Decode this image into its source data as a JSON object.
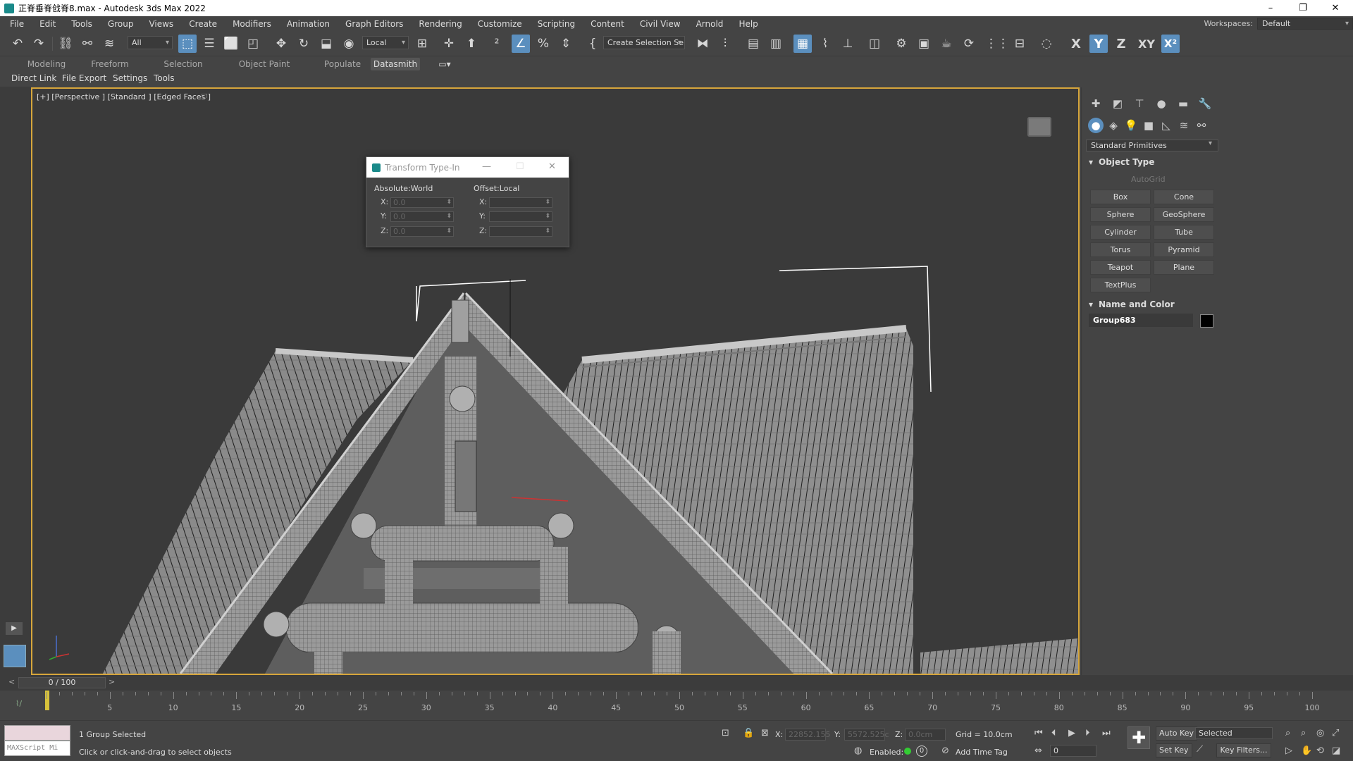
{
  "window": {
    "title": "正脊垂脊戗脊8.max - Autodesk 3ds Max 2022",
    "controls": [
      "–",
      "❐",
      "✕"
    ]
  },
  "menu": [
    "File",
    "Edit",
    "Tools",
    "Group",
    "Views",
    "Create",
    "Modifiers",
    "Animation",
    "Graph Editors",
    "Rendering",
    "Customize",
    "Scripting",
    "Content",
    "Civil View",
    "Arnold",
    "Help"
  ],
  "workspace": {
    "label": "Workspaces:",
    "value": "Default"
  },
  "toolbar": {
    "selection_filter": "All",
    "reference_coord": "Local",
    "named_selection": "Create Selection Se",
    "axis_x": "X",
    "axis_y": "Y",
    "axis_z": "Z",
    "axis_xy": "XY",
    "axis_xz": "X²"
  },
  "ribbon_tabs": [
    "Modeling",
    "Freeform",
    "Selection",
    "Object Paint",
    "Populate",
    "Datasmith"
  ],
  "ribbon_active": "Datasmith",
  "ribbon_sub": [
    "Direct Link",
    "File Export",
    "Settings",
    "Tools"
  ],
  "viewport": {
    "label": "[+] [Perspective ] [Standard ] [Edged Faces ]"
  },
  "transform_typein": {
    "title": "Transform Type-In",
    "absolute_label": "Absolute:World",
    "offset_label": "Offset:Local",
    "abs_x_label": "X:",
    "abs_y_label": "Y:",
    "abs_z_label": "Z:",
    "abs_x": "0.0",
    "abs_y": "0.0",
    "abs_z": "0.0",
    "off_x_label": "X:",
    "off_y_label": "Y:",
    "off_z_label": "Z:"
  },
  "command_panel": {
    "category": "Standard Primitives",
    "object_type_header": "Object Type",
    "autogrid": "AutoGrid",
    "primitives": [
      "Box",
      "Cone",
      "Sphere",
      "GeoSphere",
      "Cylinder",
      "Tube",
      "Torus",
      "Pyramid",
      "Teapot",
      "Plane",
      "TextPlus"
    ],
    "name_color_header": "Name and Color",
    "object_name": "Group683",
    "object_color": "#000000"
  },
  "timeline": {
    "frame_display": "0 / 100",
    "ticks": [
      "5",
      "10",
      "15",
      "20",
      "25",
      "30",
      "35",
      "40",
      "45",
      "50",
      "55",
      "60",
      "65",
      "70",
      "75",
      "80",
      "85",
      "90",
      "95",
      "100"
    ]
  },
  "status": {
    "maxscript": "MAXScript Mi",
    "selection": "1 Group Selected",
    "prompt": "Click or click-and-drag to select objects",
    "x_label": "X:",
    "x_value": "22852.155",
    "y_label": "Y:",
    "y_value": "5572.525c",
    "z_label": "Z:",
    "z_value": "0.0cm",
    "grid": "Grid = 10.0cm",
    "enabled": "Enabled:",
    "add_time_tag": "Add Time Tag",
    "auto_key": "Auto Key",
    "set_key": "Set Key",
    "key_mode": "Selected",
    "key_filters": "Key Filters...",
    "frame_field": "0"
  }
}
